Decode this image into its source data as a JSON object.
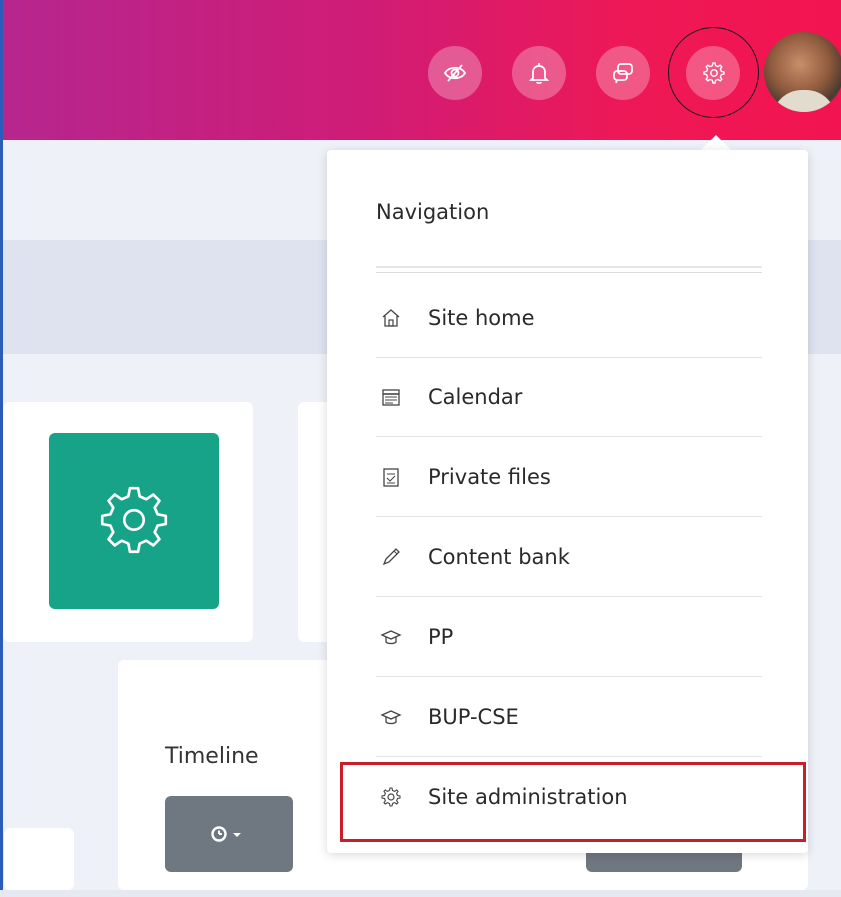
{
  "header": {
    "icons": [
      {
        "name": "eye-slash-icon"
      },
      {
        "name": "bell-icon"
      },
      {
        "name": "messages-icon"
      },
      {
        "name": "gear-icon"
      }
    ],
    "colors": {
      "gradient_start": "#b5268f",
      "gradient_end": "#f21450"
    }
  },
  "dashboard": {
    "card_icon": "gear-icon",
    "tile_color": "#17a388",
    "timeline_label": "Timeline",
    "timeline_button_icon": "clock-icon"
  },
  "dropdown": {
    "title": "Navigation",
    "items": [
      {
        "label": "Site home",
        "icon": "home-icon"
      },
      {
        "label": "Calendar",
        "icon": "calendar-icon"
      },
      {
        "label": "Private files",
        "icon": "file-icon"
      },
      {
        "label": "Content bank",
        "icon": "pencil-icon"
      },
      {
        "label": "PP",
        "icon": "graduation-cap-icon"
      },
      {
        "label": "BUP-CSE",
        "icon": "graduation-cap-icon"
      },
      {
        "label": "Site administration",
        "icon": "gear-icon"
      }
    ],
    "highlight_color": "#c81d2a"
  }
}
